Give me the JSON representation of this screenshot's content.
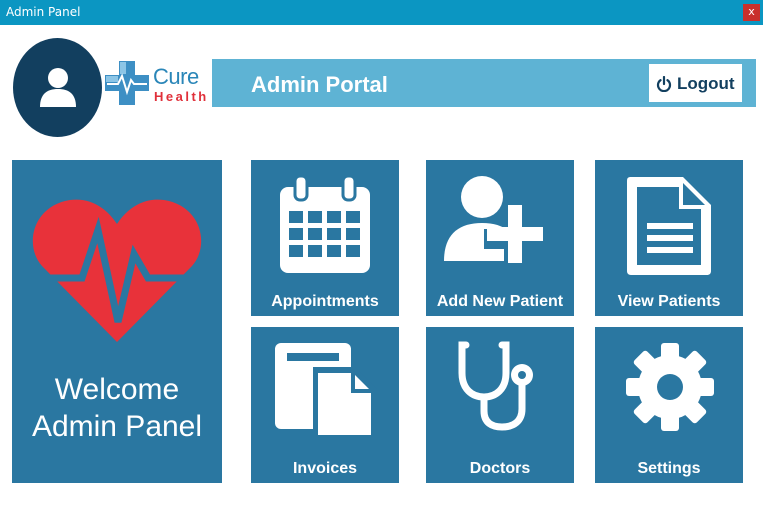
{
  "window": {
    "title": "Admin Panel",
    "close_label": "x"
  },
  "brand": {
    "name_part1": "Cure",
    "name_part2": "Health"
  },
  "header": {
    "title": "Admin Portal",
    "logout_label": "Logout"
  },
  "welcome": {
    "line1": "Welcome",
    "line2": "Admin Panel"
  },
  "tiles": [
    {
      "label": "Appointments",
      "icon": "calendar-icon"
    },
    {
      "label": "Add New Patient",
      "icon": "add-user-icon"
    },
    {
      "label": "View Patients",
      "icon": "document-icon"
    },
    {
      "label": "Invoices",
      "icon": "invoice-icon"
    },
    {
      "label": "Doctors",
      "icon": "stethoscope-icon"
    },
    {
      "label": "Settings",
      "icon": "gear-icon"
    }
  ],
  "colors": {
    "titlebar": "#0b96c2",
    "header_bar": "#5eb3d4",
    "tile": "#2a77a1",
    "avatar": "#123f5f",
    "heart": "#e8323a",
    "close_button": "#c9302c"
  }
}
